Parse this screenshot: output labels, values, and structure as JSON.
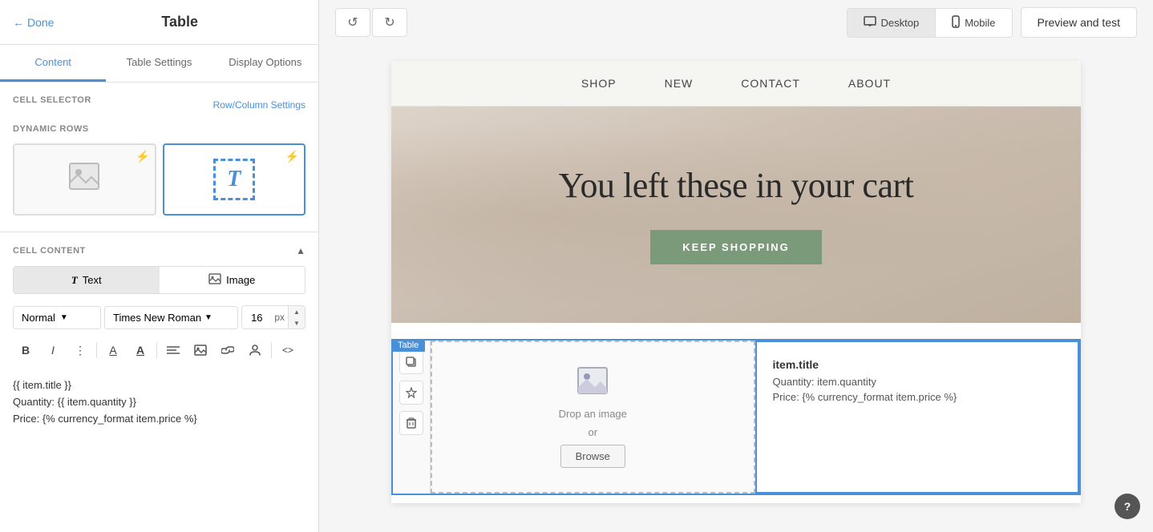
{
  "panel": {
    "done_label": "Done",
    "title": "Table",
    "tabs": [
      {
        "label": "Content",
        "active": true
      },
      {
        "label": "Table Settings",
        "active": false
      },
      {
        "label": "Display Options",
        "active": false
      }
    ]
  },
  "cell_selector": {
    "label": "CELL SELECTOR",
    "link_label": "Row/Column Settings"
  },
  "dynamic_rows": {
    "label": "DYNAMIC ROWS"
  },
  "cell_content": {
    "label": "CELL CONTENT",
    "text_btn": "Text",
    "image_btn": "Image"
  },
  "font_toolbar": {
    "style_label": "Normal",
    "font_label": "Times New Roman",
    "size_value": "16",
    "size_unit": "px"
  },
  "format_tools": {
    "bold": "B",
    "italic": "I",
    "more": "⋮",
    "text_color": "A",
    "bg_color": "A",
    "align": "≡",
    "image": "🖼",
    "link": "🔗",
    "person": "👤",
    "code": "<>"
  },
  "editor_content": {
    "line1": "{{ item.title }}",
    "line2": "Quantity: {{ item.quantity }}",
    "line3": "Price: {% currency_format item.price %}"
  },
  "topbar": {
    "undo_label": "↺",
    "redo_label": "↻",
    "desktop_label": "Desktop",
    "mobile_label": "Mobile",
    "preview_label": "Preview and test"
  },
  "email_preview": {
    "nav": {
      "items": [
        "SHOP",
        "NEW",
        "CONTACT",
        "ABOUT"
      ]
    },
    "hero": {
      "title": "You left these in your cart",
      "cta": "KEEP SHOPPING"
    },
    "table": {
      "badge": "Table",
      "image_drop_text": "Drop an image",
      "image_or": "or",
      "browse_label": "Browse",
      "item_title": "item.title",
      "item_quantity": "Quantity: item.quantity",
      "item_price": "Price: {% currency_format item.price %}"
    }
  }
}
